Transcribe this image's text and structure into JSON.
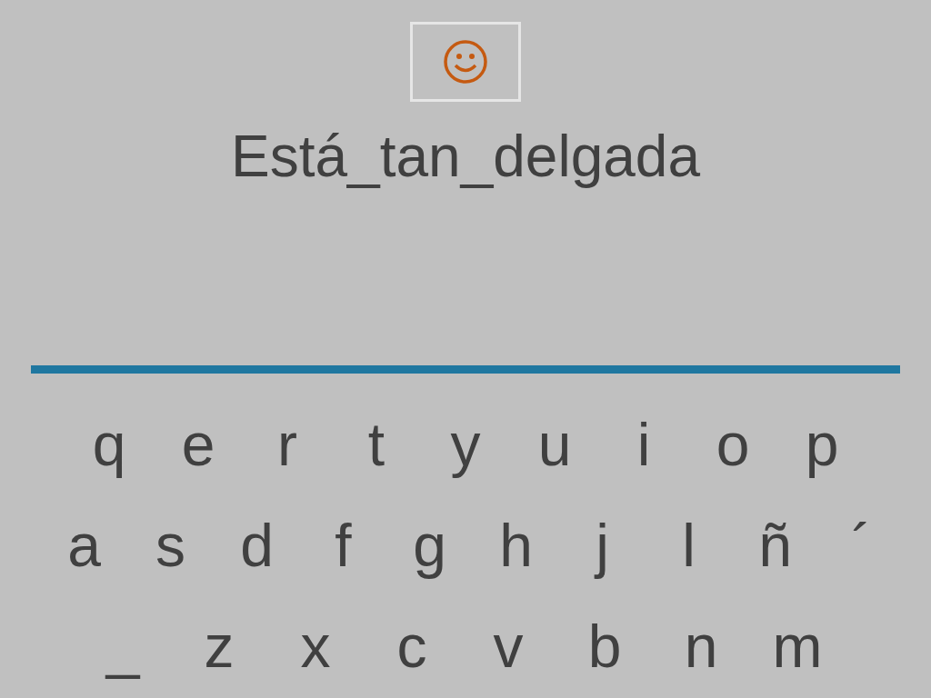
{
  "prompt": "Está_tan_delgada",
  "keyboard": {
    "rows": [
      [
        "q",
        "e",
        "r",
        "t",
        "y",
        "u",
        "i",
        "o",
        "p"
      ],
      [
        "a",
        "s",
        "d",
        "f",
        "g",
        "h",
        "j",
        "l",
        "ñ",
        "´"
      ],
      [
        "_",
        "z",
        "x",
        "c",
        "v",
        "b",
        "n",
        "m"
      ]
    ]
  }
}
